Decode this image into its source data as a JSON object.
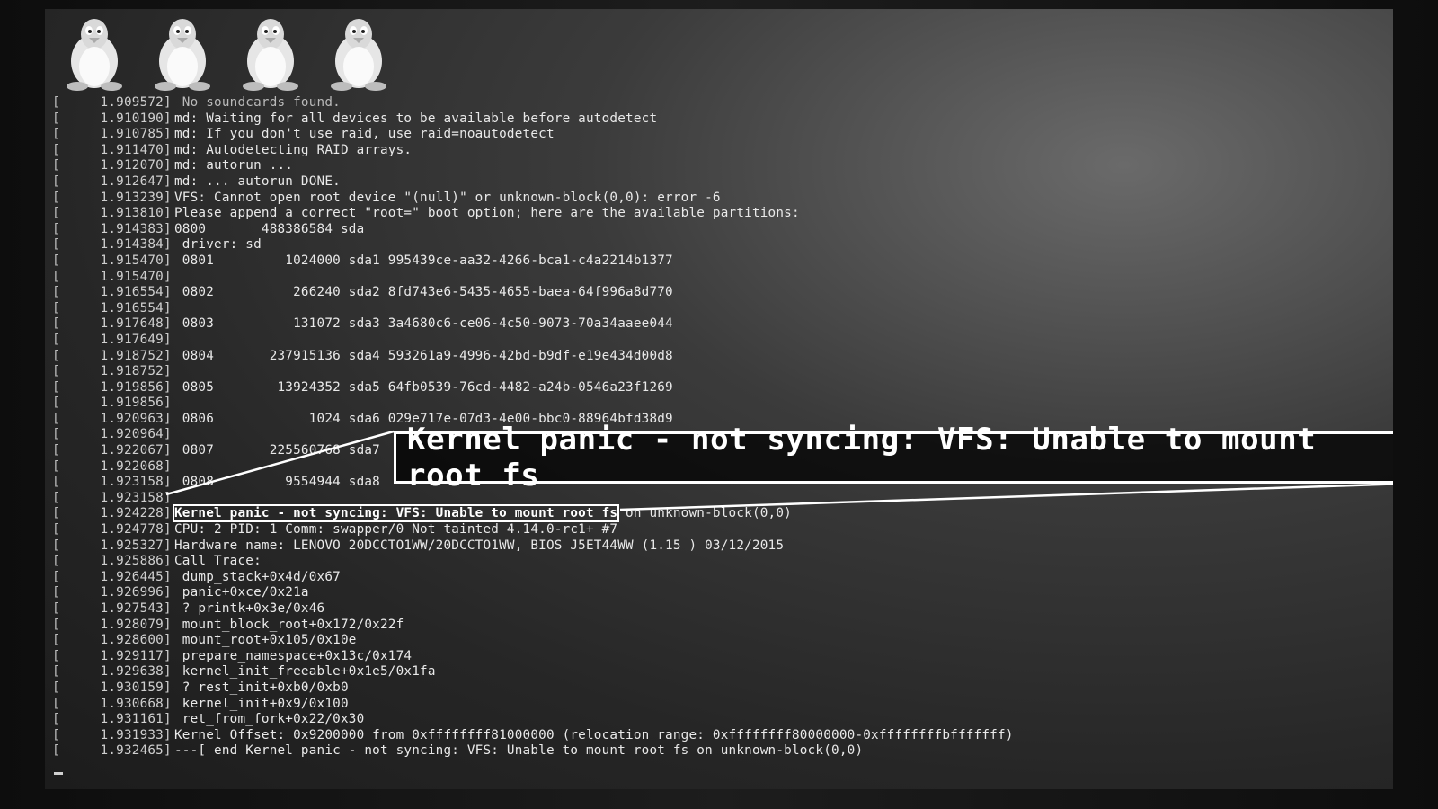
{
  "boot_logo": {
    "icons": [
      "tux-icon",
      "tux-icon",
      "tux-icon",
      "tux-icon"
    ]
  },
  "console": {
    "lines": [
      {
        "ts": "1.909572",
        "msg": " No soundcards found."
      },
      {
        "ts": "1.910190",
        "msg": "md: Waiting for all devices to be available before autodetect"
      },
      {
        "ts": "1.910785",
        "msg": "md: If you don't use raid, use raid=noautodetect"
      },
      {
        "ts": "1.911470",
        "msg": "md: Autodetecting RAID arrays."
      },
      {
        "ts": "1.912070",
        "msg": "md: autorun ..."
      },
      {
        "ts": "1.912647",
        "msg": "md: ... autorun DONE."
      },
      {
        "ts": "1.913239",
        "msg": "VFS: Cannot open root device \"(null)\" or unknown-block(0,0): error -6"
      },
      {
        "ts": "1.913810",
        "msg": "Please append a correct \"root=\" boot option; here are the available partitions:"
      },
      {
        "ts": "1.914383",
        "msg": "0800       488386584 sda"
      },
      {
        "ts": "1.914384",
        "msg": " driver: sd"
      },
      {
        "ts": "1.915470",
        "msg": " 0801         1024000 sda1 995439ce-aa32-4266-bca1-c4a2214b1377"
      },
      {
        "ts": "1.915470",
        "msg": ""
      },
      {
        "ts": "1.916554",
        "msg": " 0802          266240 sda2 8fd743e6-5435-4655-baea-64f996a8d770"
      },
      {
        "ts": "1.916554",
        "msg": ""
      },
      {
        "ts": "1.917648",
        "msg": " 0803          131072 sda3 3a4680c6-ce06-4c50-9073-70a34aaee044"
      },
      {
        "ts": "1.917649",
        "msg": ""
      },
      {
        "ts": "1.918752",
        "msg": " 0804       237915136 sda4 593261a9-4996-42bd-b9df-e19e434d00d8"
      },
      {
        "ts": "1.918752",
        "msg": ""
      },
      {
        "ts": "1.919856",
        "msg": " 0805        13924352 sda5 64fb0539-76cd-4482-a24b-0546a23f1269"
      },
      {
        "ts": "1.919856",
        "msg": ""
      },
      {
        "ts": "1.920963",
        "msg": " 0806            1024 sda6 029e717e-07d3-4e00-bbc0-88964bfd38d9"
      },
      {
        "ts": "1.920964",
        "msg": ""
      },
      {
        "ts": "1.922067",
        "msg": " 0807       225560768 sda7"
      },
      {
        "ts": "1.922068",
        "msg": ""
      },
      {
        "ts": "1.923158",
        "msg": " 0808         9554944 sda8"
      },
      {
        "ts": "1.923158",
        "msg": ""
      },
      {
        "ts": "1.924228",
        "msg": "Kernel panic - not syncing: VFS: Unable to mount root fs",
        "tail": " on unknown-block(0,0)",
        "highlight": true
      },
      {
        "ts": "1.924778",
        "msg": "CPU: 2 PID: 1 Comm: swapper/0 Not tainted 4.14.0-rc1+ #7"
      },
      {
        "ts": "1.925327",
        "msg": "Hardware name: LENOVO 20DCCTO1WW/20DCCTO1WW, BIOS J5ET44WW (1.15 ) 03/12/2015"
      },
      {
        "ts": "1.925886",
        "msg": "Call Trace:"
      },
      {
        "ts": "1.926445",
        "msg": " dump_stack+0x4d/0x67"
      },
      {
        "ts": "1.926996",
        "msg": " panic+0xce/0x21a"
      },
      {
        "ts": "1.927543",
        "msg": " ? printk+0x3e/0x46"
      },
      {
        "ts": "1.928079",
        "msg": " mount_block_root+0x172/0x22f"
      },
      {
        "ts": "1.928600",
        "msg": " mount_root+0x105/0x10e"
      },
      {
        "ts": "1.929117",
        "msg": " prepare_namespace+0x13c/0x174"
      },
      {
        "ts": "1.929638",
        "msg": " kernel_init_freeable+0x1e5/0x1fa"
      },
      {
        "ts": "1.930159",
        "msg": " ? rest_init+0xb0/0xb0"
      },
      {
        "ts": "1.930668",
        "msg": " kernel_init+0x9/0x100"
      },
      {
        "ts": "1.931161",
        "msg": " ret_from_fork+0x22/0x30"
      },
      {
        "ts": "1.931933",
        "msg": "Kernel Offset: 0x9200000 from 0xffffffff81000000 (relocation range: 0xffffffff80000000-0xffffffffbfffffff)"
      },
      {
        "ts": "1.932465",
        "msg": "---[ end Kernel panic - not syncing: VFS: Unable to mount root fs on unknown-block(0,0)"
      }
    ]
  },
  "callout": {
    "text": "Kernel panic - not syncing: VFS: Unable to mount root fs"
  }
}
